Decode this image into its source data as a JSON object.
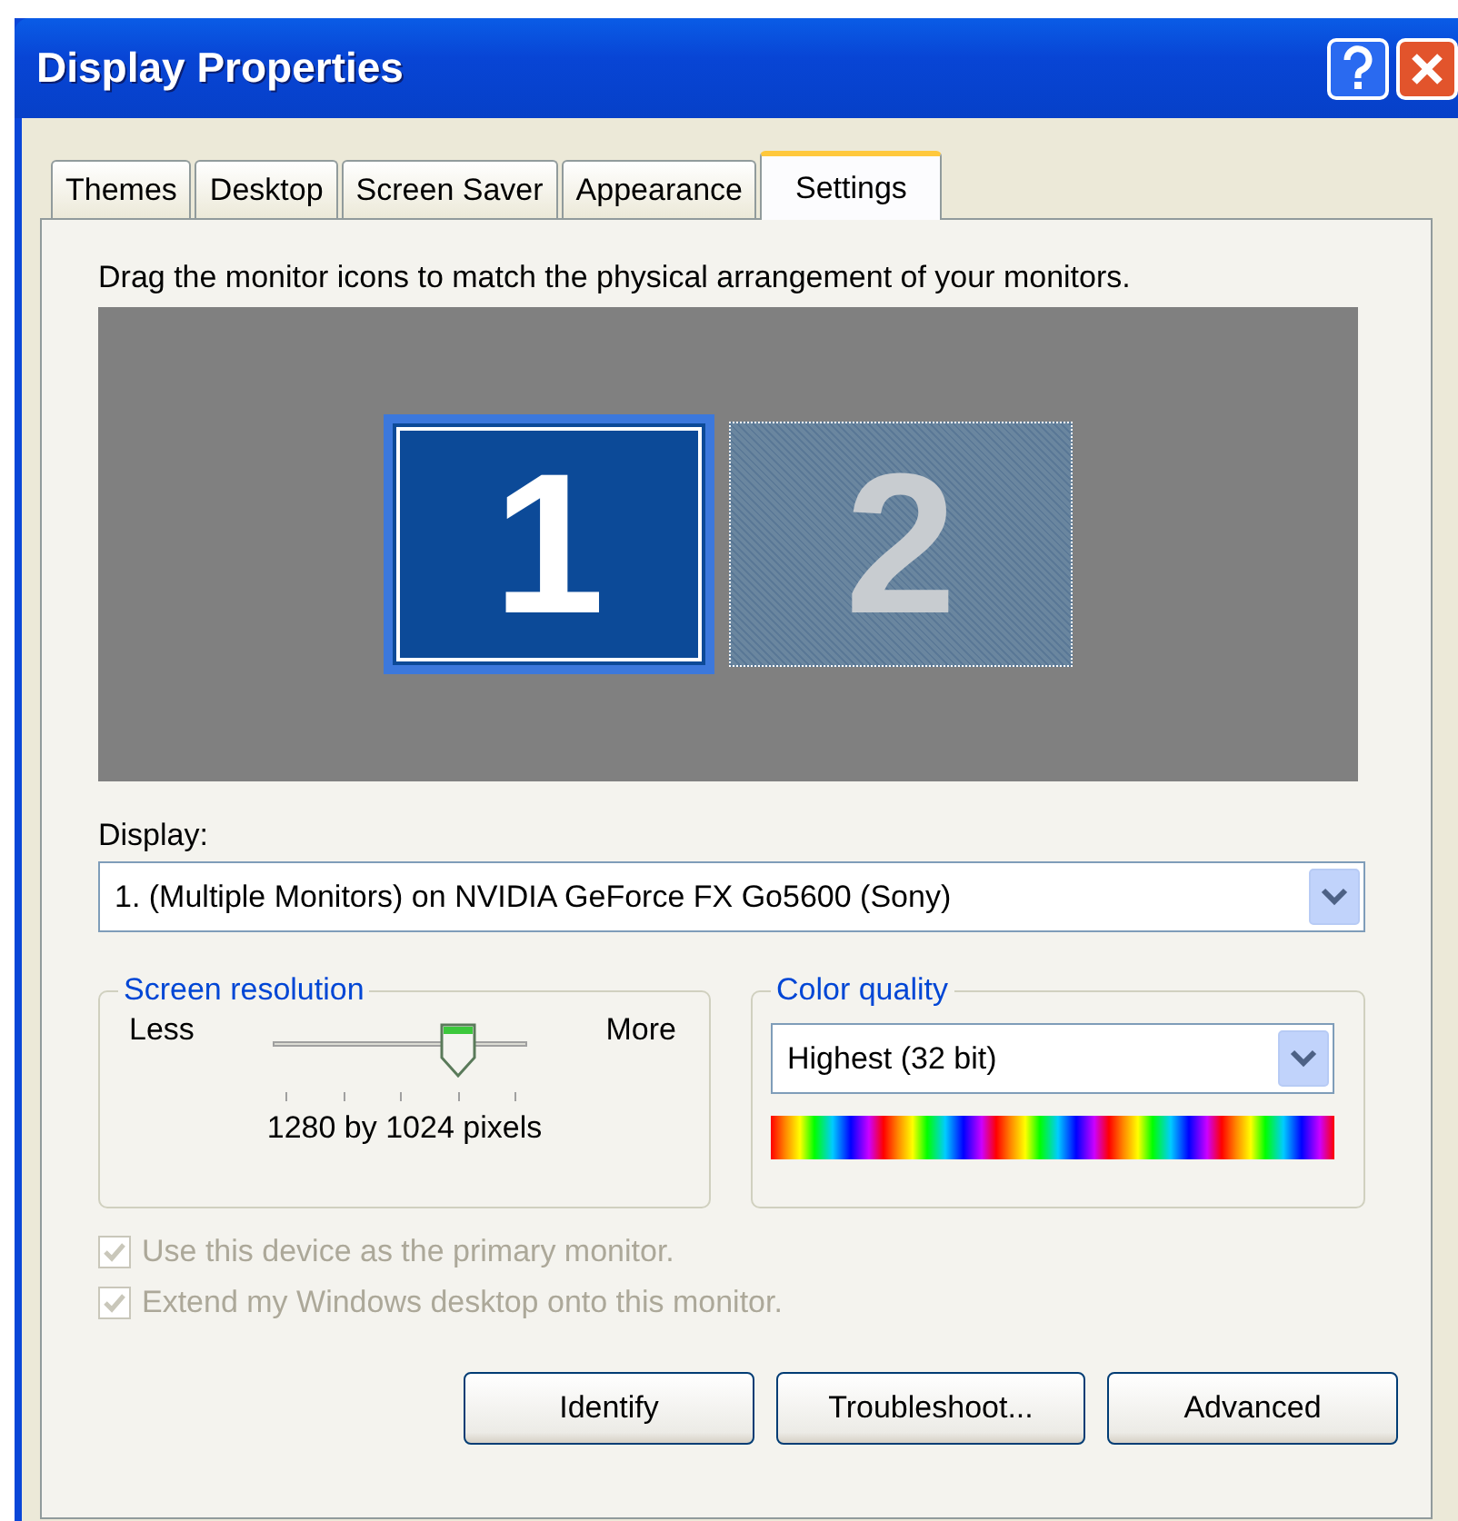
{
  "window": {
    "title": "Display Properties"
  },
  "tabs": [
    {
      "label": "Themes",
      "selected": false
    },
    {
      "label": "Desktop",
      "selected": false
    },
    {
      "label": "Screen Saver",
      "selected": false
    },
    {
      "label": "Appearance",
      "selected": false
    },
    {
      "label": "Settings",
      "selected": true
    }
  ],
  "instruction": "Drag the monitor icons to match the physical arrangement of your monitors.",
  "monitors": [
    {
      "number": "1",
      "selected": true
    },
    {
      "number": "2",
      "selected": false
    }
  ],
  "display": {
    "label": "Display:",
    "value": "1. (Multiple Monitors) on NVIDIA GeForce FX Go5600 (Sony)"
  },
  "screen_resolution": {
    "title": "Screen resolution",
    "min_label": "Less",
    "max_label": "More",
    "level": 0.75,
    "reading": "1280 by 1024 pixels"
  },
  "color_quality": {
    "title": "Color quality",
    "value": "Highest (32 bit)"
  },
  "checkboxes": [
    {
      "label": "Use this device as the primary monitor.",
      "checked": true,
      "disabled": true
    },
    {
      "label": "Extend my Windows desktop onto this monitor.",
      "checked": true,
      "disabled": true
    }
  ],
  "buttons": [
    "Identify",
    "Troubleshoot...",
    "Advanced"
  ]
}
